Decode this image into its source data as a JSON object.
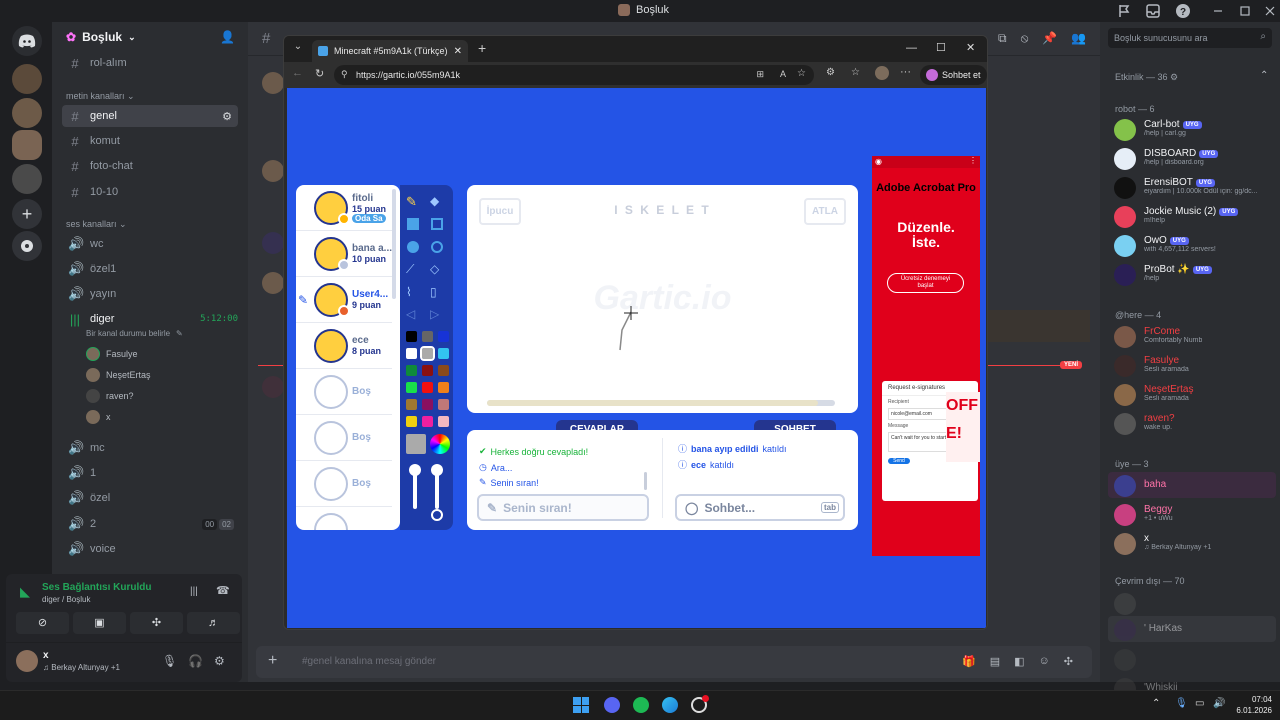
{
  "window_title": "Boşluk",
  "server": {
    "name": "Boşluk"
  },
  "channels": {
    "top_channel": "rol-alım",
    "text_category": "metin kanalları",
    "text": [
      "genel",
      "komut",
      "foto-chat",
      "10-10"
    ],
    "voice_category": "ses kanalları",
    "voice": [
      "wc",
      "özel1",
      "yayın"
    ],
    "active_voice": {
      "name": "diger",
      "timer": "5:12:00",
      "status": "Bir kanal durumu belirle",
      "users": [
        "Fasulye",
        "NeşetErtaş",
        "raven?",
        "x"
      ]
    },
    "voice_more": [
      "mc",
      "1",
      "özel",
      "2",
      "voice"
    ],
    "voice_counts": [
      "00",
      "02"
    ]
  },
  "voice_panel": {
    "title": "Ses Bağlantısı Kuruldu",
    "subtitle": "diger / Boşluk"
  },
  "user_panel": {
    "name": "x",
    "status": "Berkay Altunyay +1"
  },
  "chat": {
    "placeholder": "#genel kanalına mesaj gönder",
    "new_label": "YENİ",
    "header_channel": "#"
  },
  "members": {
    "search_placeholder": "Boşluk sunucusunu ara",
    "activity_header": "Etkinlik — 36",
    "robot_header": "robot — 6",
    "robots": [
      {
        "name": "Carl-bot",
        "badge": "UYG",
        "sub": "/help | carl.gg"
      },
      {
        "name": "DISBOARD",
        "badge": "UYG",
        "sub": "/help | disboard.org"
      },
      {
        "name": "ErensiBOT",
        "badge": "UYG",
        "sub": "eiyardım | 10.000k Ödül için: gg/dc..."
      },
      {
        "name": "Jockie Music (2)",
        "badge": "UYG",
        "sub": "m!help"
      },
      {
        "name": "OwO",
        "badge": "UYG",
        "sub": "with 4,657,112 servers!"
      },
      {
        "name": "ProBot ✨",
        "badge": "UYG",
        "sub": "/help"
      }
    ],
    "here_header": "@here — 4",
    "here": [
      {
        "name": "FrCome",
        "sub": "Comfortably Numb",
        "color": "#f23f43"
      },
      {
        "name": "Fasulye",
        "sub": "Sesli aramada",
        "color": "#f23f43"
      },
      {
        "name": "NeşetErtaş",
        "sub": "Sesli aramada",
        "color": "#f23f43"
      },
      {
        "name": "raven?",
        "sub": "wake up.",
        "color": "#f23f43"
      }
    ],
    "uye_header": "üye — 3",
    "uye": [
      {
        "name": "baha",
        "sub": "",
        "color": "#ff73a8"
      },
      {
        "name": "Beggy",
        "sub": "+1 • uWu",
        "color": "#ff73a8"
      },
      {
        "name": "x",
        "sub": "Berkay Altunyay +1",
        "color": "#f2f3f5"
      }
    ],
    "offline_header": "Çevrim dışı — 70",
    "offline": [
      "' HarKas",
      "'Whiskii"
    ]
  },
  "browser": {
    "tab_title": "Minecraft #5m9A1k (Türkçe) - Gartic",
    "url": "https://gartic.io/055m9A1k",
    "copilot_label": "Sohbet et"
  },
  "gartic": {
    "players": [
      {
        "name": "fitoli",
        "points": "15 puan",
        "badge": "Oda Sa"
      },
      {
        "name": "bana a...",
        "points": "10 puan"
      },
      {
        "name": "User4...",
        "points": "9 puan"
      },
      {
        "name": "ece",
        "points": "8 puan"
      }
    ],
    "empty_label": "Boş",
    "hint_button": "İpucu",
    "word": "I S K E L E T",
    "skip_button": "ATLA",
    "watermark": "Gartic.io",
    "answers_tab": "CEVAPLAR",
    "chat_tab": "SOHBET",
    "answers": [
      "Herkes doğru cevapladı!",
      "Ara...",
      "Senin sıran!"
    ],
    "answer_input": "Senin sıran!",
    "chat_messages": [
      {
        "user": "bana ayıp edildi",
        "text": "katıldı"
      },
      {
        "user": "ece",
        "text": "katıldı"
      }
    ],
    "chat_placeholder": "Sohbet...",
    "tab_hint": "tab"
  },
  "ad": {
    "brand": "Adobe Acrobat Pro",
    "headline": "Düzenle. İste.",
    "cta": "Ücretsiz denemeyi başlat",
    "doc_title": "Request e-signatures",
    "recipient_label": "Recipient",
    "recipient_email": "nicole@email.com",
    "message_label": "Message",
    "message_text": "Can't wait for you to start, Nicole!",
    "send": "Send"
  },
  "taskbar": {
    "time": "07:04",
    "date": "6.01.2026"
  }
}
